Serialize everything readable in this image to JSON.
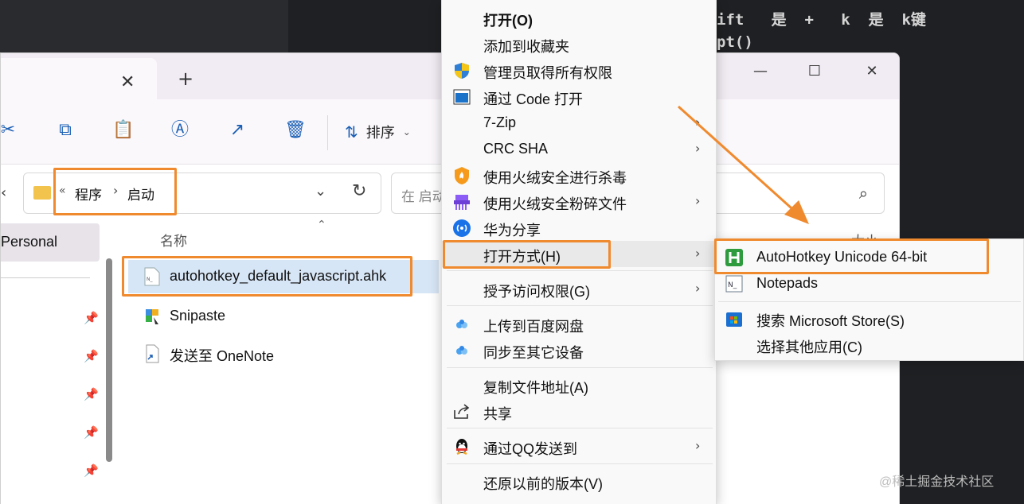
{
  "editor": {
    "line1": "ift   是  +   k  是  k键",
    "line2": "pt()"
  },
  "explorer": {
    "tab_close": "✕",
    "new_tab": "+",
    "window_controls": {
      "minimize": "—",
      "maximize": "☐",
      "close": "✕"
    },
    "toolbar": {
      "sort_label": "排序"
    },
    "address": {
      "overflow": "«",
      "crumbs": [
        "程序",
        "启动"
      ],
      "separator": "›"
    },
    "search": {
      "placeholder": "在 启动"
    },
    "sidebar": {
      "personal": "Personal"
    },
    "columns": {
      "name": "名称",
      "size": "大小"
    },
    "files": [
      {
        "name": "autohotkey_default_javascript.ahk",
        "selected": true
      },
      {
        "name": "Snipaste",
        "selected": false
      },
      {
        "name": "发送至 OneNote",
        "selected": false
      }
    ]
  },
  "context_menu": {
    "items": [
      {
        "label": "打开(O)",
        "bold": true,
        "icon": ""
      },
      {
        "label": "添加到收藏夹",
        "icon": ""
      },
      {
        "label": "管理员取得所有权限",
        "icon": "shield-icon"
      },
      {
        "label": "通过 Code 打开",
        "icon": "vscode-icon"
      },
      {
        "label": "7-Zip",
        "icon": "",
        "submenu": true
      },
      {
        "label": "CRC SHA",
        "icon": "",
        "submenu": true
      },
      {
        "label": "使用火绒安全进行杀毒",
        "icon": "huorong-icon"
      },
      {
        "label": "使用火绒安全粉碎文件",
        "icon": "shredder-icon",
        "submenu": true
      },
      {
        "label": "华为分享",
        "icon": "huawei-share-icon"
      },
      {
        "label": "打开方式(H)",
        "icon": "",
        "submenu": true
      },
      {
        "label": "授予访问权限(G)",
        "icon": "",
        "submenu": true
      },
      {
        "label": "上传到百度网盘",
        "icon": "baidu-icon"
      },
      {
        "label": "同步至其它设备",
        "icon": "baidu-icon"
      },
      {
        "label": "复制文件地址(A)",
        "icon": ""
      },
      {
        "label": "共享",
        "icon": "share-icon"
      },
      {
        "label": "通过QQ发送到",
        "icon": "qq-icon",
        "submenu": true
      },
      {
        "label": "还原以前的版本(V)",
        "icon": ""
      }
    ],
    "submenu_arrow": "›"
  },
  "open_with_submenu": {
    "items": [
      {
        "label": "AutoHotkey Unicode 64-bit",
        "icon": "autohotkey-icon"
      },
      {
        "label": "Notepads",
        "icon": "notepads-icon"
      },
      {
        "label": "搜索 Microsoft Store(S)",
        "icon": "store-icon"
      },
      {
        "label": "选择其他应用(C)",
        "icon": ""
      }
    ]
  },
  "watermark": "@稀土掘金技术社区",
  "colors": {
    "highlight": "#f08a2e",
    "selection": "#d7e6f6",
    "accent": "#1a5fb4"
  }
}
